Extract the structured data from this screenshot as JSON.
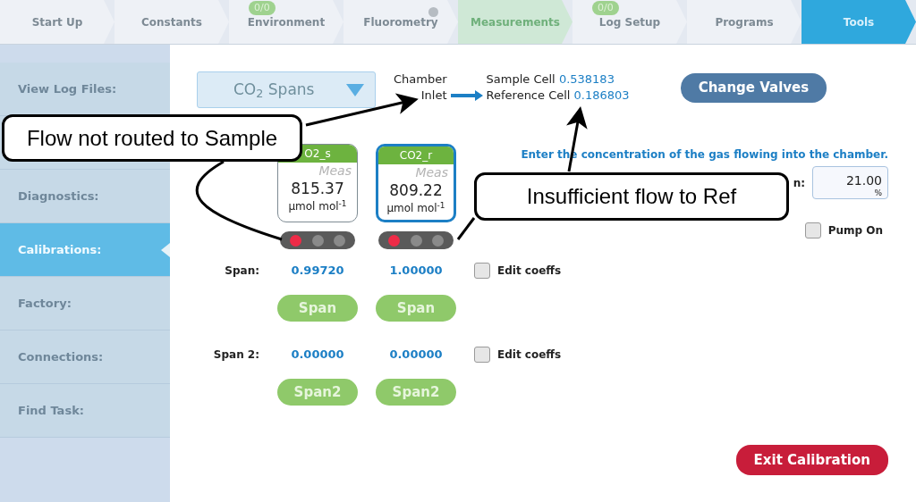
{
  "steps": [
    {
      "label": "Start Up",
      "selected": false,
      "highlighted": false
    },
    {
      "label": "Constants",
      "selected": false,
      "highlighted": false
    },
    {
      "label": "Environment",
      "selected": false,
      "highlighted": false,
      "badge": "0/0"
    },
    {
      "label": "Fluorometry",
      "selected": false,
      "highlighted": false,
      "indicator": true
    },
    {
      "label": "Measurements",
      "selected": false,
      "highlighted": true
    },
    {
      "label": "Log Setup",
      "selected": false,
      "highlighted": false,
      "badge": "0/0"
    },
    {
      "label": "Programs",
      "selected": false,
      "highlighted": false
    },
    {
      "label": "Tools",
      "selected": true,
      "highlighted": false
    }
  ],
  "sidebar": {
    "items": [
      {
        "label": "View Log Files:",
        "selected": false
      },
      {
        "label": "Diagnostics:",
        "selected": false
      },
      {
        "label": "Calibrations:",
        "selected": true
      },
      {
        "label": "Factory:",
        "selected": false
      },
      {
        "label": "Connections:",
        "selected": false
      },
      {
        "label": "Find Task:",
        "selected": false
      }
    ]
  },
  "dropdown": {
    "value": "CO$_{2}$ Spans"
  },
  "flow": {
    "source_lines": [
      "Chamber",
      "Inlet"
    ],
    "cells": [
      {
        "label": "Sample Cell",
        "value": "0.538183"
      },
      {
        "label": "Reference Cell",
        "value": "0.186803"
      }
    ]
  },
  "change_valves_button": "Change Valves",
  "sensors": [
    {
      "name": "O2_s",
      "mode": "Meas",
      "value": "815.37",
      "unit": "µmol mol$^{-1}$",
      "selected": false,
      "lights": [
        {
          "on": true
        },
        {
          "on": false
        },
        {
          "on": false
        }
      ]
    },
    {
      "name": "CO2_r",
      "mode": "Meas",
      "value": "809.22",
      "unit": "µmol mol$^{-1}$",
      "selected": true,
      "lights": [
        {
          "on": true
        },
        {
          "on": false
        },
        {
          "on": false
        }
      ]
    }
  ],
  "instruction": "Enter the concentration of the gas flowing into the chamber.",
  "concentration": {
    "label": "n:",
    "value": "21.00",
    "unit": "%"
  },
  "pump": {
    "label": "Pump On",
    "checked": false
  },
  "span_rows": [
    {
      "label": "Span:",
      "values": [
        "0.99720",
        "1.00000"
      ],
      "edit_label": "Edit coeffs",
      "edit_checked": false,
      "buttons": [
        "Span",
        "Span"
      ]
    },
    {
      "label": "Span 2:",
      "values": [
        "0.00000",
        "0.00000"
      ],
      "edit_label": "Edit coeffs",
      "edit_checked": false,
      "buttons": [
        "Span2",
        "Span2"
      ]
    }
  ],
  "exit_button": "Exit Calibration",
  "annotations": [
    {
      "text": "Flow not routed to Sample"
    },
    {
      "text": "Insufficient flow to Ref"
    }
  ]
}
